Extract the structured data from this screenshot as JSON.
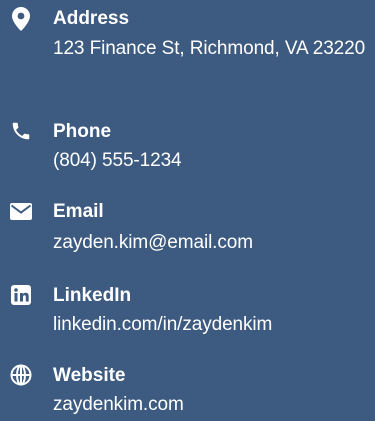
{
  "contact": {
    "items": [
      {
        "icon": "map-marker-icon",
        "label": "Address",
        "value": "123 Finance St, Richmond, VA 23220"
      },
      {
        "icon": "phone-icon",
        "label": "Phone",
        "value": "(804) 555-1234"
      },
      {
        "icon": "envelope-icon",
        "label": "Email",
        "value": "zayden.kim@email.com"
      },
      {
        "icon": "linkedin-icon",
        "label": "LinkedIn",
        "value": "linkedin.com/in/zaydenkim"
      },
      {
        "icon": "globe-icon",
        "label": "Website",
        "value": "zaydenkim.com"
      }
    ]
  },
  "colors": {
    "background": "#3d5a80",
    "text": "#ffffff"
  }
}
